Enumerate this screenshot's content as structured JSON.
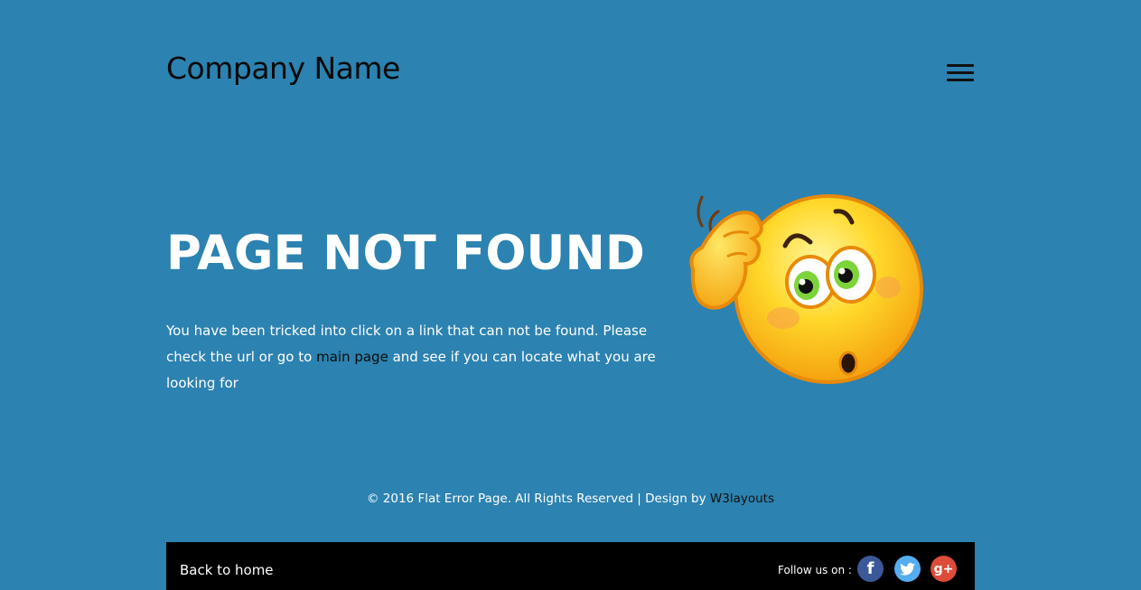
{
  "header": {
    "logo": "Company Name",
    "menu_icon": "hamburger-menu-icon"
  },
  "main": {
    "title": "PAGE NOT FOUND",
    "message_part1": "You have been tricked into click on a link that can not be found. Please check the url or go to ",
    "main_page_link": "main page",
    "message_part2": " and see if you can locate what you are looking for",
    "illustration_icon": "confused-emoji-icon"
  },
  "footer": {
    "copyright": "© 2016 Flat Error Page. All Rights Reserved | Design by ",
    "designer_link": "W3layouts",
    "back_home": "Back to home",
    "follow_label": "Follow us on :",
    "social": {
      "facebook": {
        "icon": "facebook-icon",
        "glyph": "f",
        "color": "#3b5998"
      },
      "twitter": {
        "icon": "twitter-icon",
        "glyph": "t",
        "color": "#55acee"
      },
      "googleplus": {
        "icon": "google-plus-icon",
        "glyph": "g+",
        "color": "#dd4b39"
      }
    }
  },
  "colors": {
    "background": "#2c82b0",
    "footer_bar": "#000000",
    "text": "#ffffff",
    "link": "#0b0b0b"
  }
}
